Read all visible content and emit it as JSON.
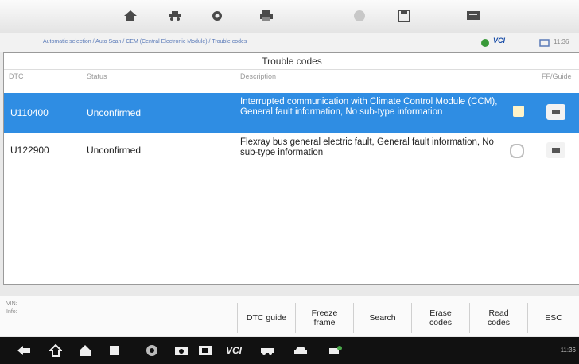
{
  "toolbar": {
    "icons": [
      "home-icon",
      "vehicle-menu-icon",
      "settings-icon",
      "print-icon",
      "help-icon",
      "save-icon",
      "data-logging-icon"
    ]
  },
  "breadcrumb": {
    "path": "Automatic selection / Auto Scan / CEM (Central Electronic Module) / Trouble codes",
    "current": "Trouble codes",
    "vci_label": "VCI",
    "time": "11:36"
  },
  "panel": {
    "title": "Trouble codes",
    "columns": {
      "dtc": "DTC",
      "status": "Status",
      "description": "Description",
      "ff": "FF/Guide"
    }
  },
  "rows": [
    {
      "dtc": "U110400",
      "status": "Unconfirmed",
      "description": "Interrupted communication with Climate Control Module (CCM), General fault information, No sub-type information",
      "selected": true
    },
    {
      "dtc": "U122900",
      "status": "Unconfirmed",
      "description": "Flexray bus general electric fault, General fault information, No sub-type information",
      "selected": false
    }
  ],
  "info": {
    "vin_label": "VIN:",
    "info_label": "Info:"
  },
  "buttons": {
    "dtc_guide": "DTC guide",
    "freeze_frame": "Freeze frame",
    "search": "Search",
    "erase_codes": "Erase codes",
    "read_codes": "Read codes",
    "esc": "ESC"
  },
  "navbar": {
    "icons": [
      "back-icon",
      "home-icon",
      "house-icon",
      "recent-apps-icon",
      "chrome-icon",
      "camera-icon",
      "screen-record-icon",
      "vci-icon",
      "vehicle-icon",
      "car-icon",
      "scan-icon"
    ],
    "vci_text": "VCI",
    "status_time": "11:36"
  },
  "colors": {
    "accent": "#2f8de3",
    "navbar": "#111111"
  }
}
